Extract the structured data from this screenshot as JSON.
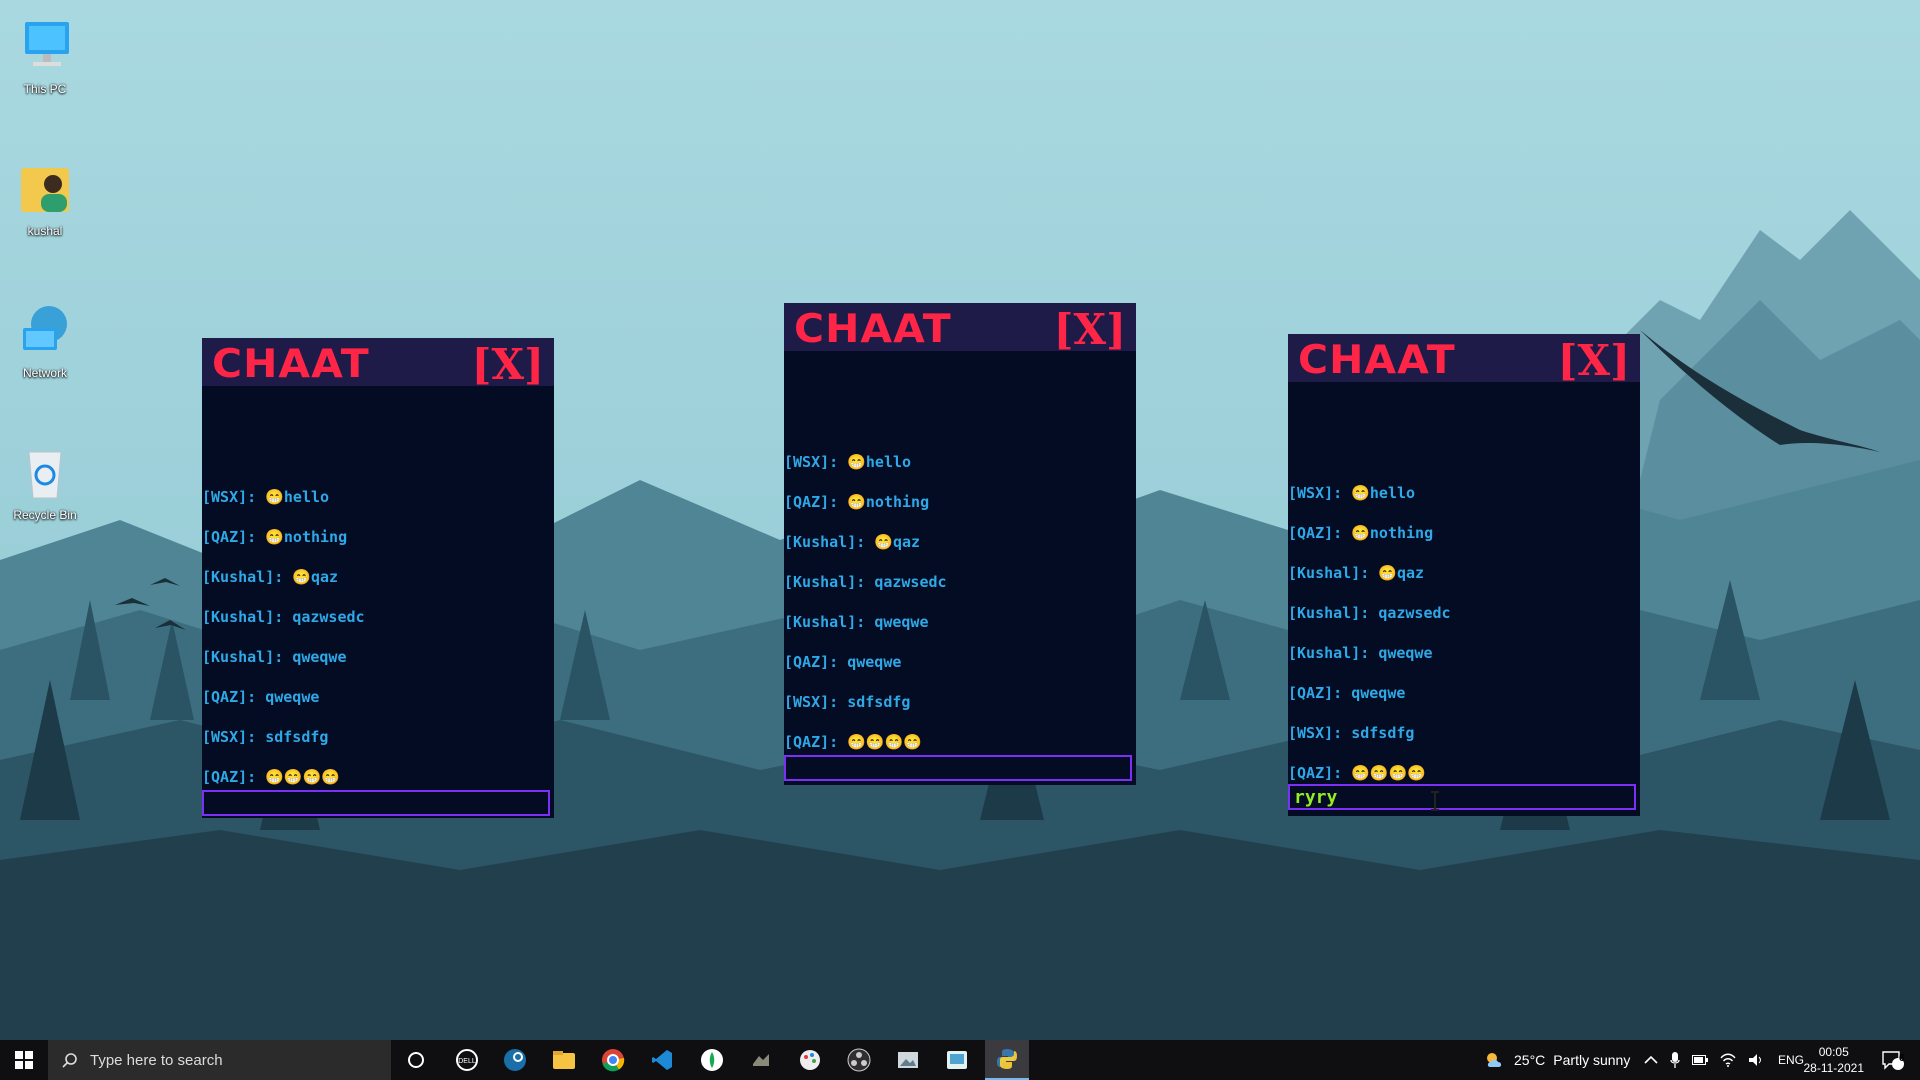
{
  "desktop": {
    "icons": [
      {
        "label": "This PC"
      },
      {
        "label": "kushal"
      },
      {
        "label": "Network"
      },
      {
        "label": "Recycle Bin"
      }
    ]
  },
  "chat_app": {
    "title": "CHAAT",
    "close_label": "[X]",
    "emoji": "😁",
    "windows": [
      {
        "messages": [
          {
            "sender": "[WSX]:",
            "text": "😁hello"
          },
          {
            "sender": "[QAZ]:",
            "text": "😁nothing"
          },
          {
            "sender": "[Kushal]:",
            "text": "😁qaz"
          },
          {
            "sender": "[Kushal]:",
            "text": "qazwsedc"
          },
          {
            "sender": "[Kushal]:",
            "text": "qweqwe"
          },
          {
            "sender": "[QAZ]:",
            "text": "qweqwe"
          },
          {
            "sender": "[WSX]:",
            "text": "sdfsdfg"
          },
          {
            "sender": "[QAZ]:",
            "text": "😁😁😁😁"
          }
        ],
        "input_value": ""
      },
      {
        "messages": [
          {
            "sender": "[WSX]:",
            "text": "😁hello"
          },
          {
            "sender": "[QAZ]:",
            "text": "😁nothing"
          },
          {
            "sender": "[Kushal]:",
            "text": "😁qaz"
          },
          {
            "sender": "[Kushal]:",
            "text": "qazwsedc"
          },
          {
            "sender": "[Kushal]:",
            "text": "qweqwe"
          },
          {
            "sender": "[QAZ]:",
            "text": "qweqwe"
          },
          {
            "sender": "[WSX]:",
            "text": "sdfsdfg"
          },
          {
            "sender": "[QAZ]:",
            "text": "😁😁😁😁"
          }
        ],
        "input_value": ""
      },
      {
        "messages": [
          {
            "sender": "[WSX]:",
            "text": "😁hello"
          },
          {
            "sender": "[QAZ]:",
            "text": "😁nothing"
          },
          {
            "sender": "[Kushal]:",
            "text": "😁qaz"
          },
          {
            "sender": "[Kushal]:",
            "text": "qazwsedc"
          },
          {
            "sender": "[Kushal]:",
            "text": "qweqwe"
          },
          {
            "sender": "[QAZ]:",
            "text": "qweqwe"
          },
          {
            "sender": "[WSX]:",
            "text": "sdfsdfg"
          },
          {
            "sender": "[QAZ]:",
            "text": "😁😁😁😁"
          }
        ],
        "input_value": "ryry"
      }
    ]
  },
  "taskbar": {
    "search_placeholder": "Type here to search",
    "pinned_apps": [
      "cortana-icon",
      "dell-icon",
      "steam-icon",
      "file-explorer-icon",
      "chrome-icon",
      "vscode-icon",
      "mongodb-compass-icon",
      "app-icon",
      "paint-icon",
      "obs-icon",
      "photos-icon",
      "snip-icon",
      "python-icon"
    ],
    "weather": {
      "temp": "25°C",
      "condition": "Partly sunny"
    },
    "language": "ENG",
    "time": "00:05",
    "date": "28-11-2021",
    "notifications": "6"
  },
  "colors": {
    "sky": "#9fd2db",
    "chat_bg": "#030c22",
    "chat_header": "#1f1b49",
    "title_red": "#ff2547",
    "message_blue": "#2fa8e8",
    "input_border": "#7b2ff7",
    "input_text": "#93ec24",
    "taskbar": "#0f0f12"
  }
}
